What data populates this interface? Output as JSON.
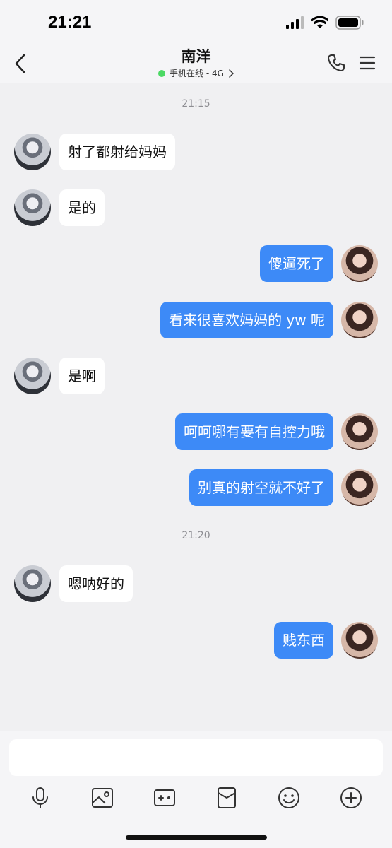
{
  "status_bar": {
    "time": "21:21",
    "icons": [
      "signal-icon",
      "wifi-icon",
      "battery-icon"
    ]
  },
  "header": {
    "contact_name": "南洋",
    "status_text": "手机在线 - 4G",
    "status_color": "#4cd964",
    "icons": [
      "back-icon",
      "phone-icon",
      "menu-icon",
      "chevron-right-icon"
    ]
  },
  "messages": [
    {
      "type": "timestamp",
      "text": "21:15"
    },
    {
      "type": "incoming",
      "text": "射了都射给妈妈"
    },
    {
      "type": "incoming",
      "text": "是的"
    },
    {
      "type": "outgoing",
      "text": "傻逼死了"
    },
    {
      "type": "outgoing",
      "text": "看来很喜欢妈妈的 yw 呢"
    },
    {
      "type": "incoming",
      "text": "是啊"
    },
    {
      "type": "outgoing",
      "text": "呵呵哪有要有自控力哦"
    },
    {
      "type": "outgoing",
      "text": "别真的射空就不好了"
    },
    {
      "type": "timestamp",
      "text": "21:20"
    },
    {
      "type": "incoming",
      "text": "嗯呐好的"
    },
    {
      "type": "outgoing",
      "text": "贱东西"
    }
  ],
  "input": {
    "value": "",
    "placeholder": ""
  },
  "toolbar": {
    "icons": [
      "microphone-icon",
      "image-icon",
      "camera-icon",
      "red-packet-icon",
      "emoji-icon",
      "plus-icon"
    ]
  },
  "colors": {
    "outgoing_bubble": "#3d8af7",
    "incoming_bubble": "#ffffff",
    "chat_background": "#f0f0f2"
  }
}
